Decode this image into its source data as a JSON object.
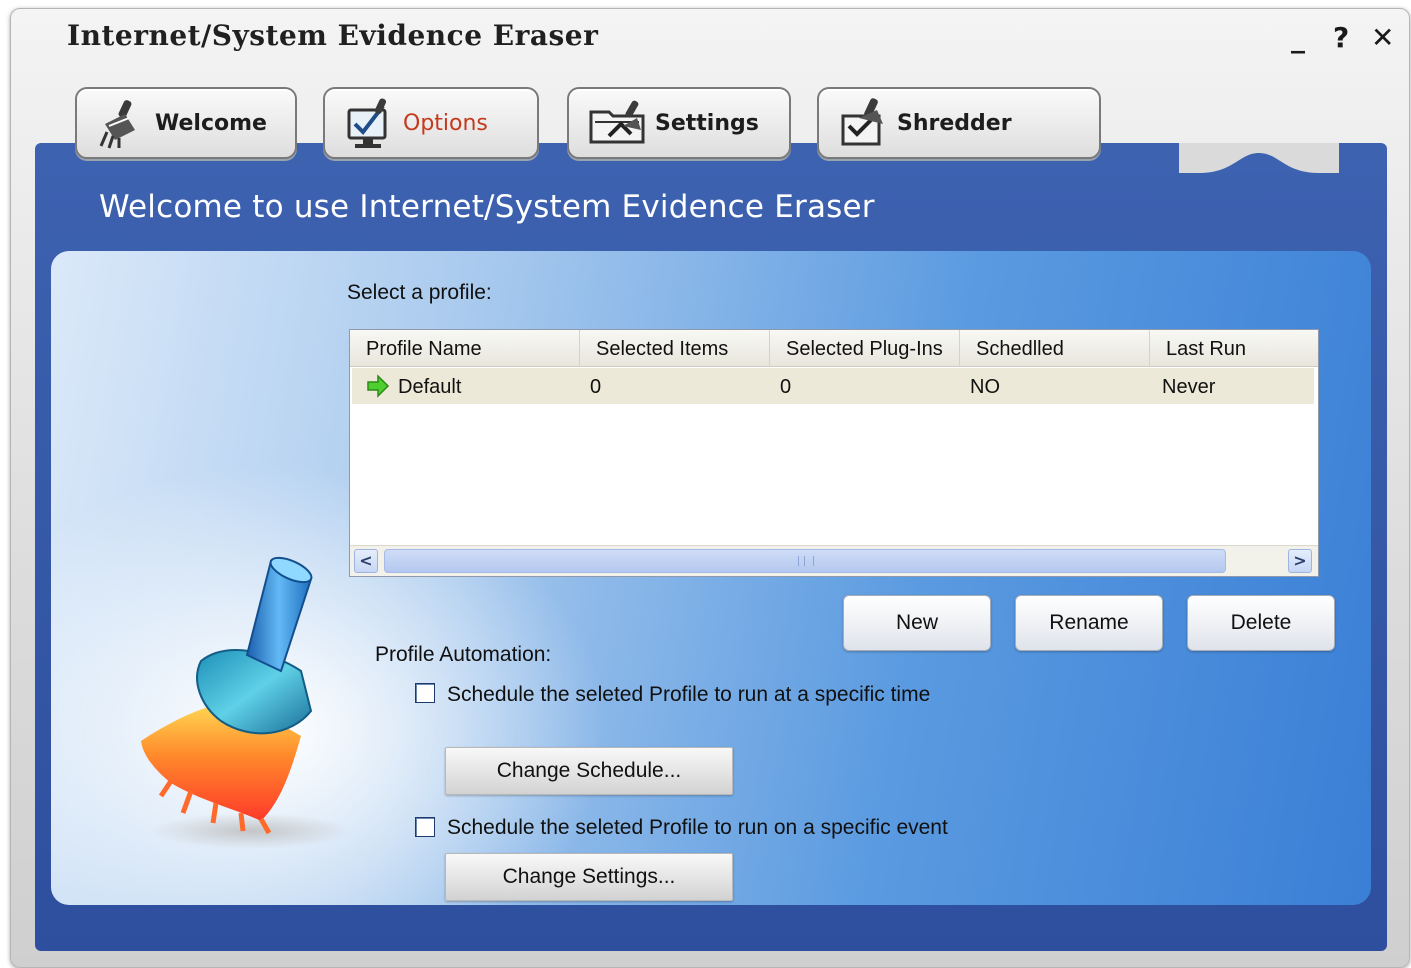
{
  "window": {
    "title": "Internet/System Evidence Eraser",
    "controls": {
      "minimize": "_",
      "help": "?",
      "close": "✕"
    }
  },
  "tabs": [
    {
      "label": "Welcome",
      "icon": "broom-icon"
    },
    {
      "label": "Options",
      "icon": "monitor-check-icon",
      "active": true
    },
    {
      "label": "Settings",
      "icon": "folder-broom-icon"
    },
    {
      "label": "Shredder",
      "icon": "shredder-broom-icon"
    }
  ],
  "heading": "Welcome to use Internet/System Evidence Eraser",
  "profile_section": {
    "label": "Select a profile:",
    "columns": [
      "Profile Name",
      "Selected Items",
      "Selected Plug-Ins",
      "Schedlled",
      "Last Run"
    ],
    "rows": [
      {
        "name": "Default",
        "selected_items": "0",
        "selected_plugins": "0",
        "scheduled": "NO",
        "last_run": "Never",
        "icon": "green-arrow-icon"
      }
    ],
    "scroll_left": "<",
    "scroll_right": ">"
  },
  "buttons": {
    "new": "New",
    "rename": "Rename",
    "delete": "Delete"
  },
  "automation": {
    "label": "Profile Automation:",
    "time_checkbox": {
      "label": "Schedule the seleted Profile to run at a specific time",
      "checked": false
    },
    "change_schedule": "Change Schedule...",
    "event_checkbox": {
      "label": "Schedule the seleted Profile to run on a specific event",
      "checked": false
    },
    "change_settings": "Change Settings..."
  },
  "colors": {
    "panel_blue": "#2e4f9e",
    "active_tab_text": "#c43a1d",
    "row_highlight": "#ece9d8"
  }
}
